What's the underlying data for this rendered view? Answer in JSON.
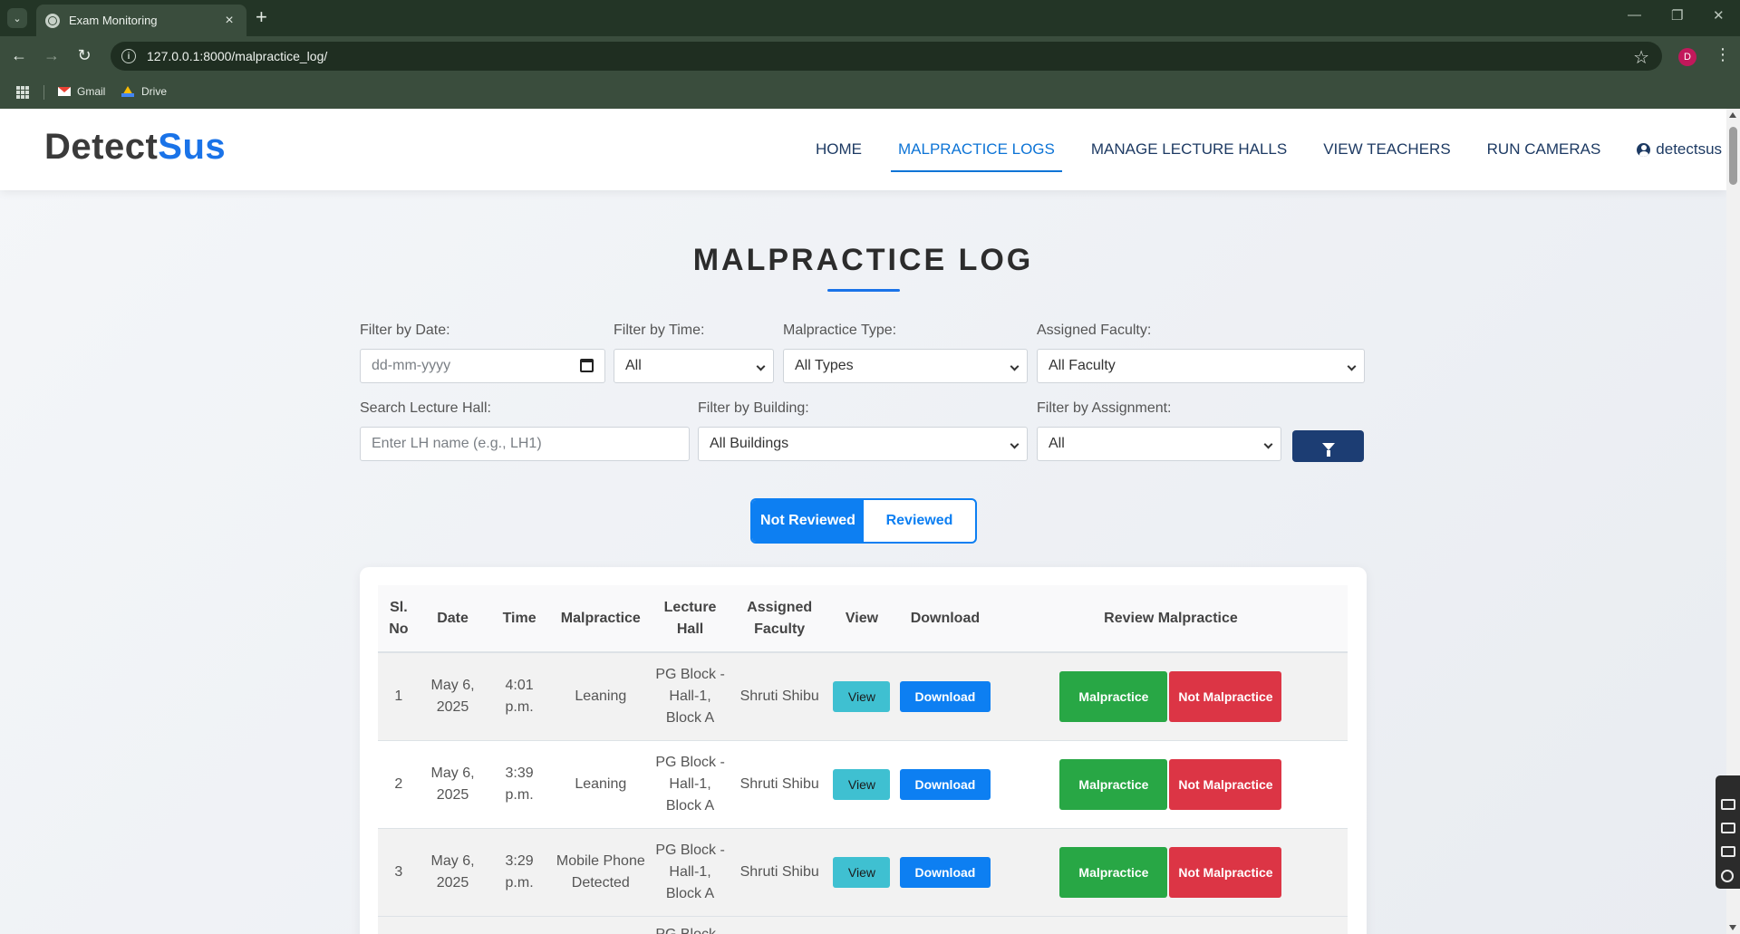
{
  "browser": {
    "tab_title": "Exam Monitoring",
    "url": "127.0.0.1:8000/malpractice_log/",
    "profile_initial": "D",
    "bookmarks": [
      {
        "label": "Gmail",
        "icon": "gmail-icon"
      },
      {
        "label": "Drive",
        "icon": "drive-icon"
      }
    ]
  },
  "site": {
    "brand_part1": "Detect",
    "brand_part2": "Sus",
    "brand_color": "#1a73e8",
    "nav": [
      {
        "label": "HOME",
        "active": false
      },
      {
        "label": "MALPRACTICE LOGS",
        "active": true
      },
      {
        "label": "MANAGE LECTURE HALLS",
        "active": false
      },
      {
        "label": "VIEW TEACHERS",
        "active": false
      },
      {
        "label": "RUN CAMERAS",
        "active": false
      }
    ],
    "user": "detectsus"
  },
  "page": {
    "title": "MALPRACTICE LOG"
  },
  "filters": {
    "date": {
      "label": "Filter by Date:",
      "placeholder": "dd-mm-yyyy"
    },
    "time": {
      "label": "Filter by Time:",
      "value": "All"
    },
    "type": {
      "label": "Malpractice Type:",
      "value": "All Types"
    },
    "faculty": {
      "label": "Assigned Faculty:",
      "value": "All Faculty"
    },
    "hall": {
      "label": "Search Lecture Hall:",
      "placeholder": "Enter LH name (e.g., LH1)"
    },
    "building": {
      "label": "Filter by Building:",
      "value": "All Buildings"
    },
    "assignment": {
      "label": "Filter by Assignment:",
      "value": "All"
    }
  },
  "toggle": {
    "not_reviewed": "Not Reviewed",
    "reviewed": "Reviewed",
    "active": "not_reviewed"
  },
  "table": {
    "headers": {
      "sl_no": "Sl. No",
      "date": "Date",
      "time": "Time",
      "malpractice": "Malpractice",
      "lecture_hall": "Lecture Hall",
      "faculty": "Assigned Faculty",
      "view": "View",
      "download": "Download",
      "review": "Review Malpractice"
    },
    "rows": [
      {
        "sl": "1",
        "date": "May 6, 2025",
        "time": "4:01 p.m.",
        "malpractice": "Leaning",
        "hall": "PG Block - Hall-1, Block A",
        "faculty": "Shruti Shibu"
      },
      {
        "sl": "2",
        "date": "May 6, 2025",
        "time": "3:39 p.m.",
        "malpractice": "Leaning",
        "hall": "PG Block - Hall-1, Block A",
        "faculty": "Shruti Shibu"
      },
      {
        "sl": "3",
        "date": "May 6, 2025",
        "time": "3:29 p.m.",
        "malpractice": "Mobile Phone Detected",
        "hall": "PG Block - Hall-1, Block A",
        "faculty": "Shruti Shibu"
      }
    ],
    "partial_row_hall": "PG Block -",
    "buttons": {
      "view": "View",
      "download": "Download",
      "malpractice": "Malpractice",
      "not_malpractice": "Not Malpractice"
    }
  },
  "colors": {
    "primary": "#0d7ff2",
    "success": "#28a745",
    "danger": "#dc3545",
    "info": "#3fc0d1",
    "navy": "#1c3d73"
  }
}
